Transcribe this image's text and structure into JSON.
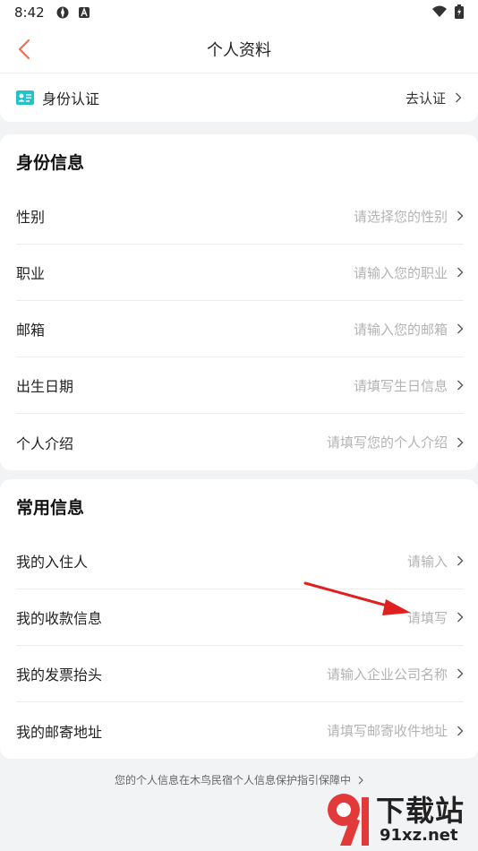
{
  "status_bar": {
    "time": "8:42"
  },
  "nav": {
    "title": "个人资料"
  },
  "verify": {
    "label": "身份认证",
    "action": "去认证"
  },
  "identity": {
    "title": "身份信息",
    "rows": [
      {
        "label": "性别",
        "placeholder": "请选择您的性别"
      },
      {
        "label": "职业",
        "placeholder": "请输入您的职业"
      },
      {
        "label": "邮箱",
        "placeholder": "请输入您的邮箱"
      },
      {
        "label": "出生日期",
        "placeholder": "请填写生日信息"
      },
      {
        "label": "个人介绍",
        "placeholder": "请填写您的个人介绍"
      }
    ]
  },
  "common": {
    "title": "常用信息",
    "rows": [
      {
        "label": "我的入住人",
        "placeholder": "请输入"
      },
      {
        "label": "我的收款信息",
        "placeholder": "请填写"
      },
      {
        "label": "我的发票抬头",
        "placeholder": "请输入企业公司名称"
      },
      {
        "label": "我的邮寄地址",
        "placeholder": "请填写邮寄收件地址"
      }
    ]
  },
  "footer": {
    "note": "您的个人信息在木鸟民宿个人信息保护指引保障中"
  },
  "watermark": {
    "brand": "下载站",
    "url": "91xz.net"
  },
  "colors": {
    "accent": "#f36d5a",
    "verify_icon": "#22c4c9",
    "annotation_arrow": "#e02020"
  }
}
